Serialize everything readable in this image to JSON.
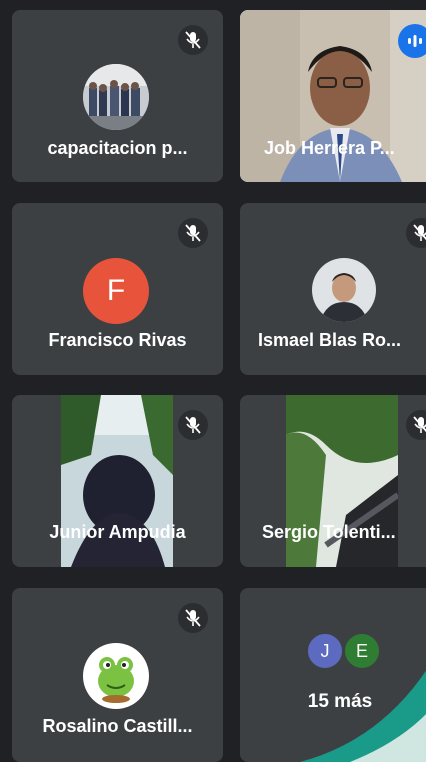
{
  "participants": [
    {
      "name": "capacitacion p...",
      "muted": true,
      "avatar": "group-photo"
    },
    {
      "name": "Job Herrera P...",
      "speaking": true,
      "video": true
    },
    {
      "name": "Francisco Rivas",
      "muted": true,
      "avatar_letter": "F",
      "avatar_color": "#e8533c"
    },
    {
      "name": "Ismael Blas Ro...",
      "muted": true,
      "avatar": "person-photo"
    },
    {
      "name": "Junior Ampudia",
      "muted": true,
      "video": true
    },
    {
      "name": "Sergio Tolenti...",
      "muted": true,
      "video": true
    },
    {
      "name": "Rosalino Castill...",
      "muted": true,
      "avatar": "frog-cartoon"
    }
  ],
  "overflow": {
    "label": "15 más",
    "avatars": [
      {
        "letter": "J",
        "color": "#5c6bc0"
      },
      {
        "letter": "E",
        "color": "#2e7d32"
      }
    ]
  },
  "colors": {
    "background": "#202124",
    "tile": "#3c4043",
    "active_border": "#8ab4f8",
    "speaking": "#1a73e8",
    "accent_corner": "#1a9b8a"
  },
  "icons": [
    "mic-off-icon",
    "audio-wave-icon"
  ]
}
